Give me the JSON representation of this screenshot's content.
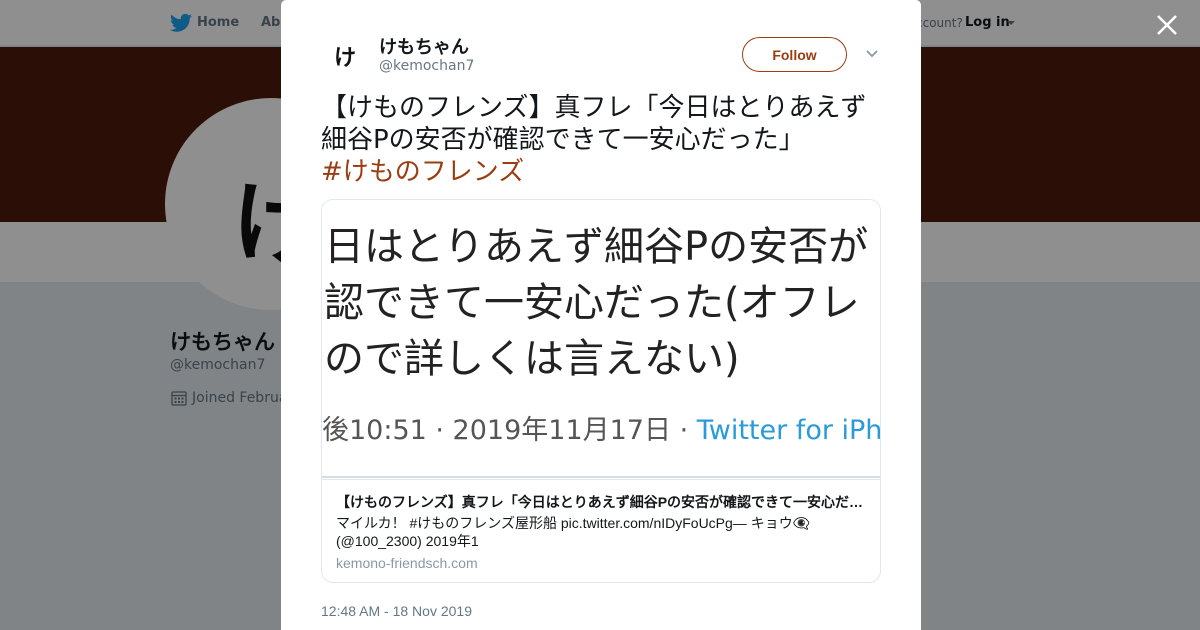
{
  "nav": {
    "home_label": "Home",
    "about_label": "Abo",
    "account_text": "ccount?",
    "login_label": "Log in"
  },
  "profile": {
    "avatar_glyph": "け",
    "name": "けもちゃん",
    "handle": "@kemochan7",
    "joined_text": "Joined Februa",
    "banner_color": "#4d1a0a"
  },
  "tweet": {
    "author_name": "けもちゃん",
    "author_handle": "@kemochan7",
    "avatar_glyph": "け",
    "follow_label": "Follow",
    "text": "【けものフレンズ】真フレ「今日はとりあえず細谷Pの安否が確認できて一安心だった」",
    "hashtag": "#けものフレンズ",
    "timestamp": "12:48 AM - 18 Nov 2019",
    "accent_color": "#9a3d10"
  },
  "card": {
    "image_lines": [
      "日はとりあえず細谷Pの安否が",
      "認できて一安心だった(オフレ",
      "ので詳しくは言えない)"
    ],
    "image_meta": "後10:51 · 2019年11月17日 · ",
    "image_client": "Twitter for iPhone",
    "title": "【けものフレンズ】真フレ「今日はとりあえず細谷Pの安否が確認できて一安心だ…",
    "description": "マイルカ！ #けものフレンズ屋形船 pic.twitter.com/nIDyFoUcPg— キョウ👁‍🗨 (@100_2300) 2019年1",
    "domain": "kemono-friendsch.com"
  },
  "icons": {
    "bird": "twitter-bird-icon",
    "close": "close-icon",
    "chevron": "chevron-down-icon",
    "calendar": "calendar-icon"
  }
}
